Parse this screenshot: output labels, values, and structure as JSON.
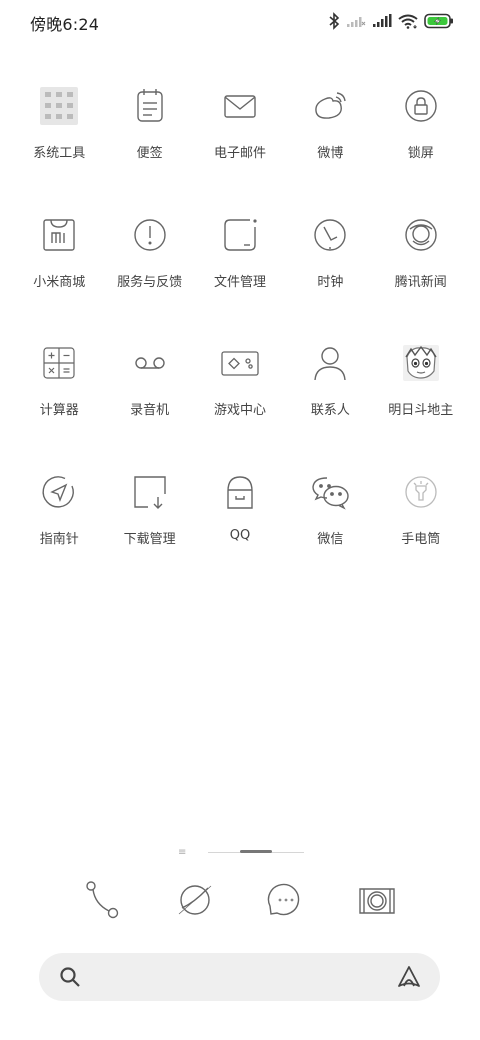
{
  "status_bar": {
    "time": "傍晚6:24",
    "icons": [
      "bluetooth-icon",
      "signal-weak-icon",
      "signal-full-icon",
      "wifi-icon",
      "battery-charging-icon"
    ],
    "battery_color": "#3cc83c"
  },
  "apps": [
    {
      "label": "系统工具",
      "icon": "system-tools-folder-icon"
    },
    {
      "label": "便签",
      "icon": "notes-icon"
    },
    {
      "label": "电子邮件",
      "icon": "email-icon"
    },
    {
      "label": "微博",
      "icon": "weibo-icon"
    },
    {
      "label": "锁屏",
      "icon": "lock-icon"
    },
    {
      "label": "小米商城",
      "icon": "mi-store-icon"
    },
    {
      "label": "服务与反馈",
      "icon": "feedback-icon"
    },
    {
      "label": "文件管理",
      "icon": "file-manager-icon"
    },
    {
      "label": "时钟",
      "icon": "clock-icon"
    },
    {
      "label": "腾讯新闻",
      "icon": "tencent-news-icon"
    },
    {
      "label": "计算器",
      "icon": "calculator-icon"
    },
    {
      "label": "录音机",
      "icon": "recorder-icon"
    },
    {
      "label": "游戏中心",
      "icon": "game-center-icon"
    },
    {
      "label": "联系人",
      "icon": "contacts-icon"
    },
    {
      "label": "明日斗地主",
      "icon": "landlord-game-icon"
    },
    {
      "label": "指南针",
      "icon": "compass-icon"
    },
    {
      "label": "下载管理",
      "icon": "download-manager-icon"
    },
    {
      "label": "QQ",
      "icon": "qq-icon"
    },
    {
      "label": "微信",
      "icon": "wechat-icon"
    },
    {
      "label": "手电筒",
      "icon": "flashlight-icon"
    }
  ],
  "page_indicator": {
    "menu_glyph": "≡",
    "pages": 3,
    "current": 2
  },
  "dock": [
    {
      "icon": "phone-icon"
    },
    {
      "icon": "browser-icon"
    },
    {
      "icon": "messages-icon"
    },
    {
      "icon": "camera-icon"
    }
  ],
  "search_bar": {
    "left_icon": "search-icon",
    "right_icon": "assistant-icon"
  }
}
